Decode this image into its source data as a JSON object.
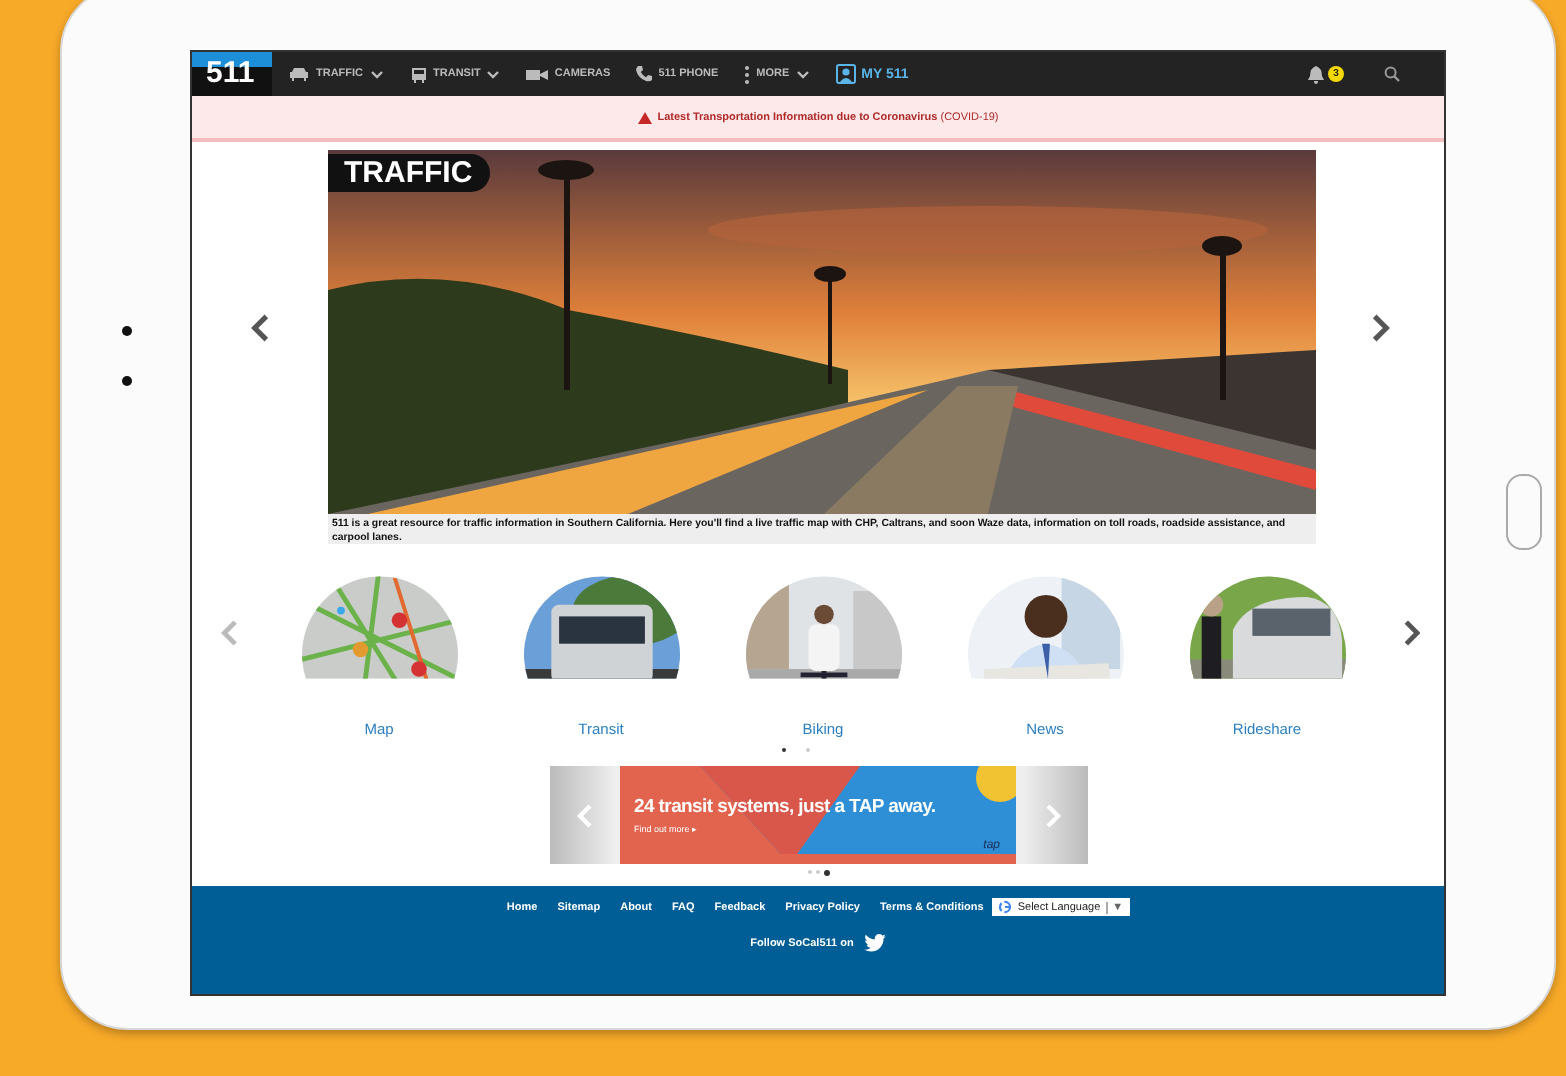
{
  "nav": {
    "logo": "511",
    "items": [
      {
        "label": "TRAFFIC",
        "dropdown": true,
        "kind": "link"
      },
      {
        "label": "TRANSIT",
        "dropdown": true,
        "kind": "link"
      },
      {
        "label": "CAMERAS",
        "dropdown": false,
        "kind": "link"
      },
      {
        "label": "511 PHONE",
        "dropdown": false,
        "kind": "link"
      },
      {
        "label": "MORE",
        "dropdown": true,
        "kind": "link"
      },
      {
        "label": "MY 511",
        "dropdown": false,
        "kind": "account"
      }
    ],
    "notification_count": "3"
  },
  "alert": {
    "text": "**Latest Transportation Information due to Coronavirus** (COVID-19)"
  },
  "hero": {
    "badge": "TRAFFIC",
    "caption": "511 is a great resource for traffic information in Southern California. Here you'll find a live traffic map with CHP, Caltrans, and soon Waze data, information on toll roads, roadside assistance, and carpool lanes."
  },
  "features": {
    "items": [
      {
        "label": "Map",
        "kind": "picture"
      },
      {
        "label": "Transit",
        "kind": "picture"
      },
      {
        "label": "Biking",
        "kind": "picture"
      },
      {
        "label": "News",
        "kind": "picture"
      },
      {
        "label": "Rideshare",
        "kind": "picture"
      }
    ],
    "dots": [
      {
        "selected": true
      },
      {
        "selected": false
      }
    ]
  },
  "ad": {
    "headline": "24 transit systems, just a TAP away.",
    "link": "Find out more ▸",
    "brand": "tap",
    "dots": [
      {
        "selected": false
      },
      {
        "selected": false
      },
      {
        "selected": true
      }
    ]
  },
  "footer": {
    "links": [
      "Home",
      "Sitemap",
      "About",
      "FAQ",
      "Feedback",
      "Privacy Policy",
      "Terms & Conditions"
    ],
    "language": "Select Language",
    "language_caret": "▼",
    "follow": "Follow SoCal511 on"
  }
}
